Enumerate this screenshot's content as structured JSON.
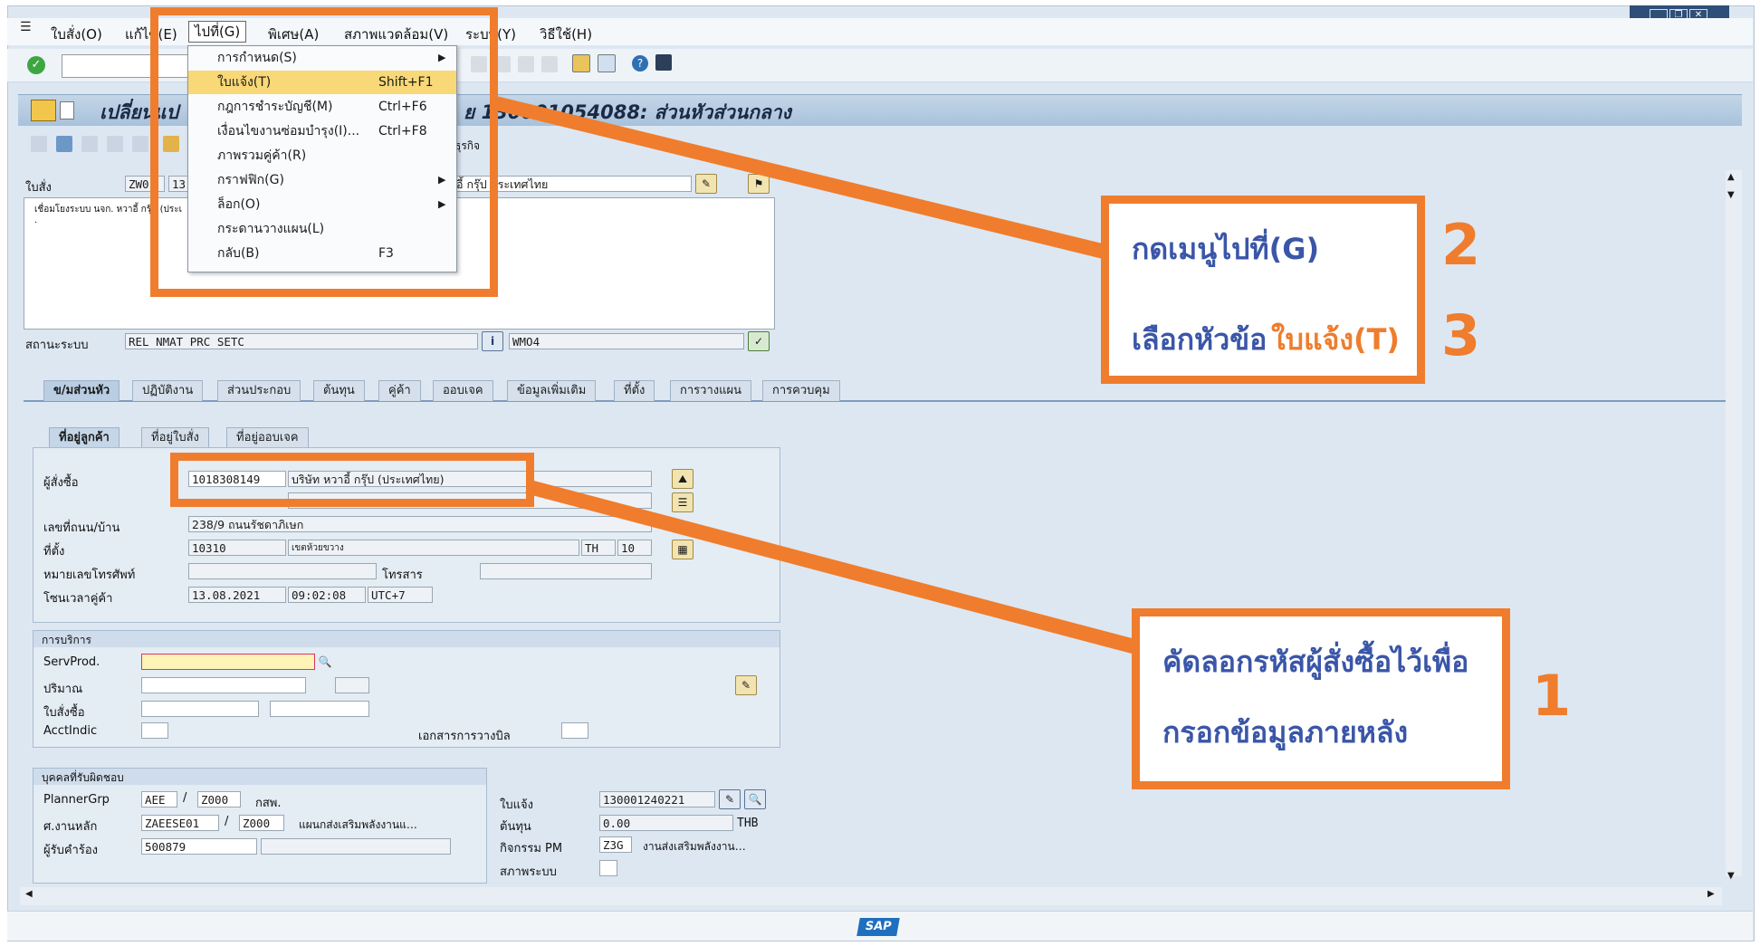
{
  "menubar": {
    "items": [
      {
        "label": "ใบสั่ง(O)"
      },
      {
        "label": "แก้ไข(E)"
      },
      {
        "label": "ไปที่(G)"
      },
      {
        "label": "พิเศษ(A)"
      },
      {
        "label": "สภาพแวดล้อม(V)"
      },
      {
        "label": "ระบบ(Y)"
      },
      {
        "label": "วิธีใช้(H)"
      }
    ]
  },
  "goto_menu": {
    "items": [
      {
        "label": "การกำหนด(S)",
        "shortcut": "",
        "submenu": true
      },
      {
        "label": "ใบแจ้ง(T)",
        "shortcut": "Shift+F1",
        "submenu": false,
        "highlighted": true
      },
      {
        "label": "กฎการชำระบัญชี(M)",
        "shortcut": "Ctrl+F6",
        "submenu": false
      },
      {
        "label": "เงื่อนไขงานซ่อมบำรุง(I)...",
        "shortcut": "Ctrl+F8",
        "submenu": false
      },
      {
        "label": "ภาพรวมคู่ค้า(R)",
        "shortcut": "",
        "submenu": false
      },
      {
        "label": "กราฟฟิก(G)",
        "shortcut": "",
        "submenu": true
      },
      {
        "label": "ล็อก(O)",
        "shortcut": "",
        "submenu": true
      },
      {
        "label": "กระดานวางแผน(L)",
        "shortcut": "",
        "submenu": false
      },
      {
        "label": "กลับ(B)",
        "shortcut": "F3",
        "submenu": false
      }
    ]
  },
  "title": "เปลี่ยนแปลง ใบสั่งซ่อมบำรุงย่อย 130001054088: ส่วนหัวส่วนกลาง",
  "title_visible_left": "เปลี่ยนแป",
  "title_visible_right": "ย 130001054088: ส่วนหัวส่วนกลาง",
  "apptoolbar_label": "ธุรกิจ",
  "header": {
    "order_label": "ใบสั่ง",
    "order_type": "ZW0",
    "order_no_fragment": "13",
    "order_desc_fragment": "อี้ กรุ๊ป ประเทศไทย",
    "longtext_line1": "เชื่อมโยงระบบ นจก. หวาอี้ กรุ๊ป (ประเ",
    "longtext_line2": ".",
    "status_label": "สถานะระบบ",
    "status_value": "REL  NMAT PRC  SETC",
    "user_status": "WMO4"
  },
  "tabs": [
    {
      "label": "ข/มส่วนหัว",
      "selected": true
    },
    {
      "label": "ปฏิบัติงาน"
    },
    {
      "label": "ส่วนประกอบ"
    },
    {
      "label": "ต้นทุน"
    },
    {
      "label": "คู่ค้า"
    },
    {
      "label": "ออบเจค"
    },
    {
      "label": "ข้อมูลเพิ่มเติม"
    },
    {
      "label": "ที่ตั้ง"
    },
    {
      "label": "การวางแผน"
    },
    {
      "label": "การควบคุม"
    }
  ],
  "subtabs": [
    {
      "label": "ที่อยู่ลูกค้า",
      "selected": true
    },
    {
      "label": "ที่อยู่ใบสั่ง"
    },
    {
      "label": "ที่อยู่ออบเจค"
    }
  ],
  "address": {
    "buyer_label": "ผู้สั่งซื้อ",
    "buyer_code": "1018308149",
    "buyer_name": "บริษัท หวาอี้ กรุ๊ป (ประเทศไทย)",
    "street_label": "เลขที่ถนน/บ้าน",
    "street": "238/9 ถนนรัชดาภิเษก",
    "location_label": "ที่ตั้ง",
    "postal": "10310",
    "district": "เขตห้วยขวาง",
    "country": "TH",
    "region": "10",
    "phone_label": "หมายเลขโทรศัพท์",
    "phone": "",
    "fax_label": "โทรสาร",
    "fax": "",
    "timezone_label": "โซนเวลาคู่ค้า",
    "date": "13.08.2021",
    "time": "09:02:08",
    "tz": "UTC+7"
  },
  "service": {
    "title": "การบริการ",
    "servprod_label": "ServProd.",
    "qty_label": "ปริมาณ",
    "po_label": "ใบสั่งซื้อ",
    "acct_label": "AcctIndic",
    "billing_doc_label": "เอกสารการวางบิล"
  },
  "responsible": {
    "title": "บุคคลที่รับผิดชอบ",
    "planner_label": "PlannerGrp",
    "planner_code": "AEE",
    "planner_plant": "Z000",
    "planner_desc": "กสพ.",
    "workcenter_label": "ศ.งานหลัก",
    "workcenter_code": "ZAEESE01",
    "workcenter_plant": "Z000",
    "workcenter_desc": "แผนกส่งเสริมพลังงานแ…",
    "requester_label": "ผู้รับคำร้อง",
    "requester": "500879",
    "notif_label": "ใบแจ้ง",
    "notif_no": "130001240221",
    "cost_label": "ต้นทุน",
    "cost": "0.00",
    "currency": "THB",
    "pm_activity_label": "กิจกรรม PM",
    "pm_activity": "Z3G",
    "pm_activity_desc": "งานส่งเสริมพลังงาน…",
    "sys_status_label": "สภาพระบบ"
  },
  "callouts": {
    "step2": "กดเมนูไปที่(G)",
    "step2_num": "2",
    "step3_prefix": "เลือกหัวข้อ",
    "step3_highlight": "ใบแจ้ง(T)",
    "step3_num": "3",
    "step1_line1": "คัดลอกรหัสผู้สั่งซื้อไว้เพื่อ",
    "step1_line2": "กรอกข้อมูลภายหลัง",
    "step1_num": "1"
  },
  "statusbar": {
    "logo": "SAP"
  },
  "colors": {
    "annotation_orange": "#ef7d2d",
    "annotation_blue": "#3a56a8",
    "menu_highlight": "#f8d877"
  }
}
